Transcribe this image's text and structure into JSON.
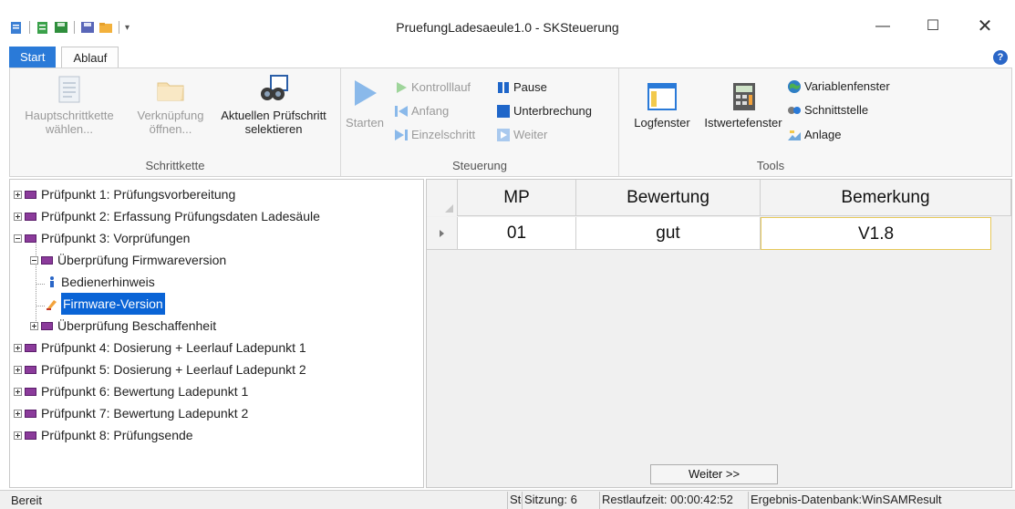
{
  "window": {
    "title": "PruefungLadesaeule1.0 - SKSteuerung",
    "minimize": "—",
    "maximize": "☐",
    "close": "✕"
  },
  "ribbon_tabs": [
    {
      "label": "Start",
      "active": true
    },
    {
      "label": "Ablauf",
      "active": false
    }
  ],
  "help_icon": "?",
  "ribbon": {
    "schrittkette": {
      "label": "Schrittkette",
      "buttons": [
        {
          "line1": "Hauptschrittkette",
          "line2": "wählen...",
          "enabled": false
        },
        {
          "line1": "Verknüpfung",
          "line2": "öffnen...",
          "enabled": false
        },
        {
          "line1": "Aktuellen Prüfschritt",
          "line2": "selektieren",
          "enabled": true
        }
      ]
    },
    "steuerung": {
      "label": "Steuerung",
      "starten": "Starten",
      "kontrolllauf": "Kontrolllauf",
      "anfang": "Anfang",
      "einzelschritt": "Einzelschritt",
      "pause": "Pause",
      "unterbrechung": "Unterbrechung",
      "weiter": "Weiter"
    },
    "tools": {
      "label": "Tools",
      "logfenster": "Logfenster",
      "istwertefenster": "Istwertefenster",
      "variablenfenster": "Variablenfenster",
      "schnittstelle": "Schnittstelle",
      "anlage": "Anlage"
    }
  },
  "tree": [
    {
      "label": "Prüfpunkt 1: Prüfungsvorbereitung"
    },
    {
      "label": "Prüfpunkt 2: Erfassung Prüfungsdaten Ladesäule"
    },
    {
      "label": "Prüfpunkt 3: Vorprüfungen"
    },
    {
      "label": "Überprüfung Firmwareversion"
    },
    {
      "label": "Bedienerhinweis"
    },
    {
      "label": "Firmware-Version",
      "selected": true
    },
    {
      "label": "Überprüfung Beschaffenheit"
    },
    {
      "label": "Prüfpunkt 4: Dosierung + Leerlauf Ladepunkt 1"
    },
    {
      "label": "Prüfpunkt 5: Dosierung + Leerlauf Ladepunkt 2"
    },
    {
      "label": "Prüfpunkt 6: Bewertung Ladepunkt 1"
    },
    {
      "label": "Prüfpunkt 7: Bewertung Ladepunkt 2"
    },
    {
      "label": "Prüfpunkt 8: Prüfungsende"
    }
  ],
  "grid": {
    "columns": [
      "MP",
      "Bewertung",
      "Bemerkung"
    ],
    "rows": [
      [
        "01",
        "gut",
        "V1.8"
      ]
    ]
  },
  "weiter_button": "Weiter >>",
  "statusbar": {
    "ready": "Bereit",
    "stop": "Stop",
    "sitzung": "Sitzung: 6",
    "restlaufzeit": "Restlaufzeit: 00:00:42:52",
    "ergebnis": "Ergebnis-Datenbank:WinSAMResult"
  }
}
